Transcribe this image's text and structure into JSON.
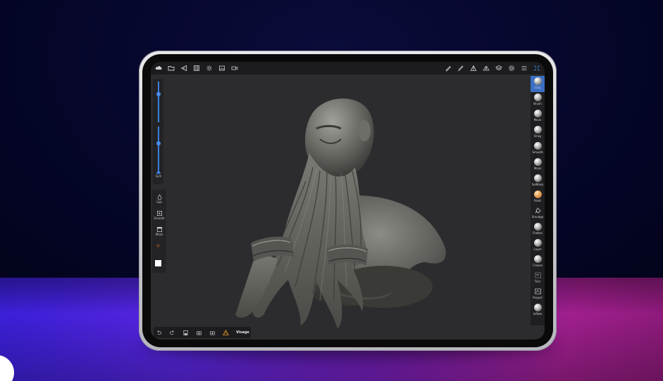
{
  "app": {
    "left_panel": {
      "sym_label": "Sym",
      "tools": [
        {
          "label": "Sub",
          "icon": "drop-icon"
        },
        {
          "label": "Smooth",
          "icon": "play-square-icon"
        },
        {
          "label": "Mask",
          "icon": "square-outline-icon"
        }
      ]
    },
    "brushes": [
      {
        "label": "Clay",
        "active": true
      },
      {
        "label": "Brush"
      },
      {
        "label": "Move"
      },
      {
        "label": "Drag"
      },
      {
        "label": "Smooth"
      },
      {
        "label": "Mask"
      },
      {
        "label": "SelMask"
      },
      {
        "label": "Paint"
      },
      {
        "label": "Smudge"
      },
      {
        "label": "Flatten"
      },
      {
        "label": "Layer"
      },
      {
        "label": "Crease"
      },
      {
        "label": "Trim"
      },
      {
        "label": "Project"
      },
      {
        "label": "Inflate"
      }
    ],
    "bottom_bar": {
      "mesh_name": "Visage"
    },
    "colors": {
      "accent": "#3a6fc4",
      "warning": "#f0a020",
      "paint": "#e9a45a"
    }
  }
}
